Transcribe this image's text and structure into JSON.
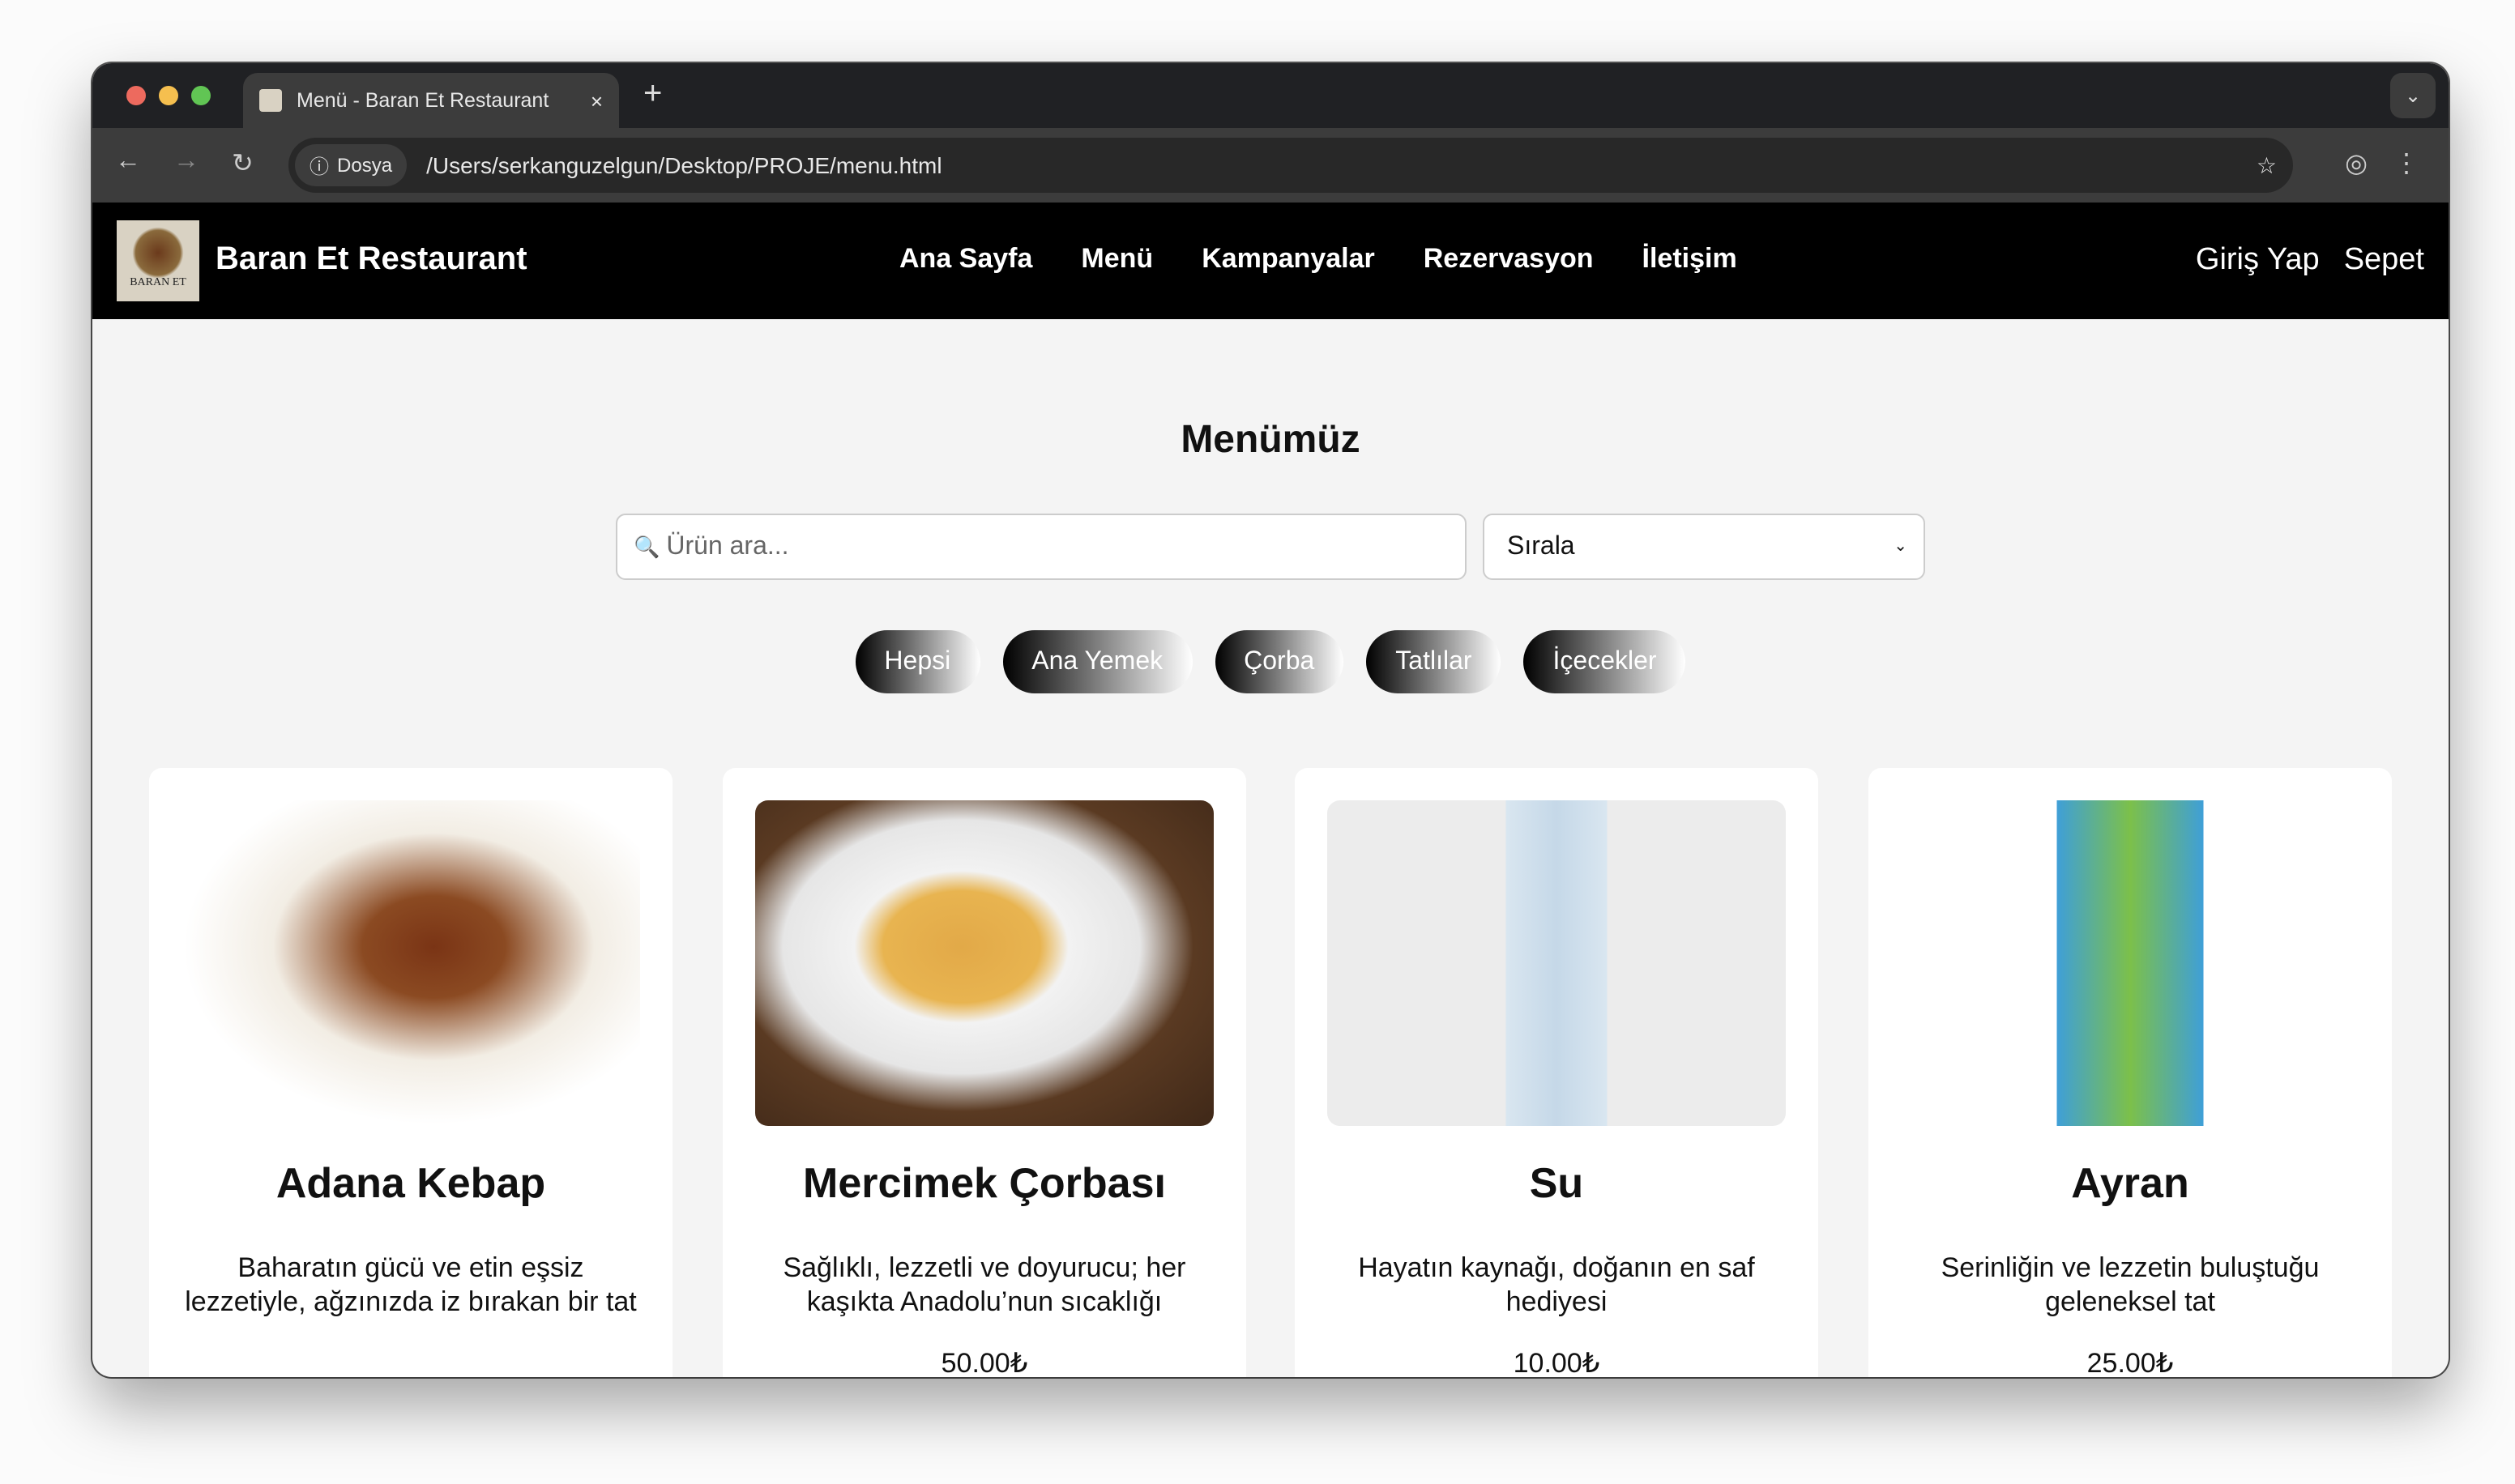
{
  "browser": {
    "tab_title": "Menü - Baran Et Restaurant",
    "tab_close": "×",
    "new_tab": "+",
    "tab_menu": "⌄",
    "security_chip": "Dosya",
    "url": "/Users/serkanguzelgun/Desktop/PROJE/menu.html"
  },
  "nav": {
    "logo_text": "BARAN ET RESTAURANT",
    "brand": "Baran Et Restaurant",
    "links": [
      "Ana Sayfa",
      "Menü",
      "Kampanyalar",
      "Rezervasyon",
      "İletişim"
    ],
    "right": [
      "Giriş Yap",
      "Sepet"
    ]
  },
  "page": {
    "title": "Menümüz",
    "search_placeholder": "Ürün ara...",
    "sort_value": "Sırala",
    "filters": [
      "Hepsi",
      "Ana Yemek",
      "Çorba",
      "Tatlılar",
      "İçecekler"
    ],
    "products": [
      {
        "name": "Adana Kebap",
        "description": "Baharatın gücü ve etin eşsiz lezzetiyle, ağzınızda iz bırakan bir tat",
        "price": ""
      },
      {
        "name": "Mercimek Çorbası",
        "description": "Sağlıklı, lezzetli ve doyurucu; her kaşıkta Anadolu’nun sıcaklığı",
        "price": "50.00₺"
      },
      {
        "name": "Su",
        "description": "Hayatın kaynağı, doğanın en saf hediyesi",
        "price": "10.00₺"
      },
      {
        "name": "Ayran",
        "description": "Serinliğin ve lezzetin buluştuğu geleneksel tat",
        "price": "25.00₺"
      }
    ]
  }
}
